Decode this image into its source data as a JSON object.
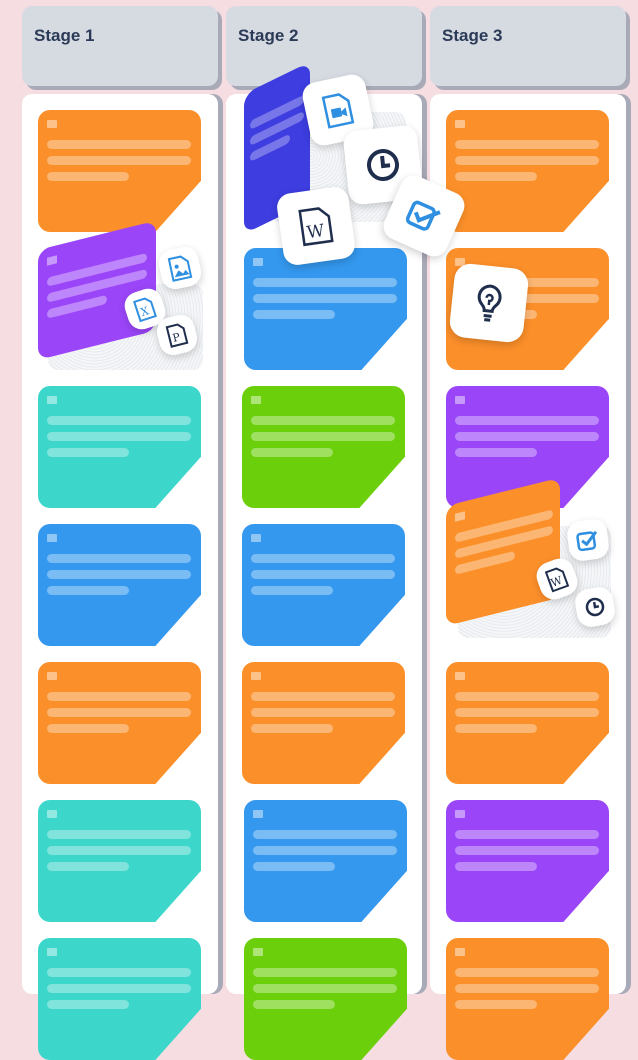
{
  "board": {
    "columns": [
      {
        "title": "Stage 1",
        "cards": [
          "orange",
          "purple",
          "teal",
          "blue",
          "orange",
          "teal",
          "teal"
        ]
      },
      {
        "title": "Stage 2",
        "cards": [
          "blue",
          "blue",
          "green",
          "blue",
          "orange",
          "blue",
          "green"
        ]
      },
      {
        "title": "Stage 3",
        "cards": [
          "orange",
          "orange",
          "purple",
          "orange",
          "orange",
          "purple",
          "orange"
        ]
      }
    ]
  },
  "colors": {
    "background": "#f5dde1",
    "header": "#d6dbe2",
    "orange": "#fb8f2a",
    "purple": "#9a45f7",
    "teal": "#3dd6cb",
    "blue": "#3498ee",
    "green": "#6ccf0b",
    "indigo": "#3d3de0",
    "icon_blue": "#2f8fe0",
    "icon_dark": "#1f2e4d"
  },
  "icons": {
    "stage1_cluster": [
      "image-file-icon",
      "excel-file-icon",
      "powerpoint-file-icon"
    ],
    "stage2_cluster": [
      "video-file-icon",
      "clock-icon",
      "checkbox-icon",
      "word-file-icon"
    ],
    "stage3_lightbulb": "lightbulb-icon",
    "stage3_cluster": [
      "checkbox-icon",
      "word-file-icon",
      "clock-icon"
    ],
    "letters": {
      "word": "W",
      "excel": "X",
      "powerpoint": "P"
    }
  }
}
